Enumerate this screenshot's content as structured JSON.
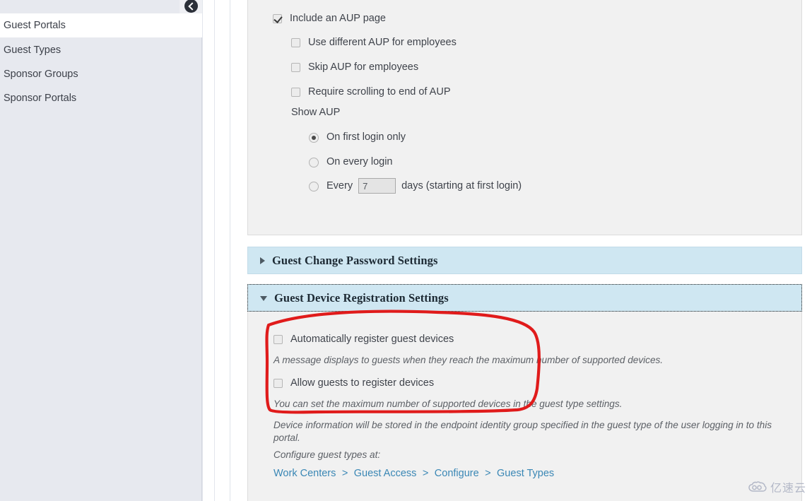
{
  "sidebar": {
    "collapse_icon": "chevron-left-circle-icon",
    "items": [
      {
        "label": "Guest Portals",
        "selected": true
      },
      {
        "label": "Guest Types",
        "selected": false
      },
      {
        "label": "Sponsor Groups",
        "selected": false
      },
      {
        "label": "Sponsor Portals",
        "selected": false
      }
    ]
  },
  "aup_panel": {
    "include_aup": {
      "label": "Include an AUP page",
      "checked": true
    },
    "sub_options": [
      {
        "label": "Use different AUP for employees",
        "checked": false
      },
      {
        "label": "Skip AUP for employees",
        "checked": false
      },
      {
        "label": "Require scrolling to end of AUP",
        "checked": false
      }
    ],
    "show_aup_label": "Show AUP",
    "radio_options": [
      {
        "label": "On first login only",
        "selected": true
      },
      {
        "label": "On every login",
        "selected": false
      },
      {
        "label": "Every",
        "selected": false
      }
    ],
    "days_value": "7",
    "days_placeholder": "",
    "days_suffix": "days (starting at first login)"
  },
  "accordions": [
    {
      "title": "Guest Change Password Settings",
      "expanded": false,
      "arrow": "triangle-right-icon"
    },
    {
      "title": "Guest Device Registration Settings",
      "expanded": true,
      "arrow": "triangle-down-icon"
    }
  ],
  "device_panel": {
    "checkboxes": [
      {
        "label": "Automatically register guest devices",
        "checked": false
      },
      {
        "label": "Allow guests to register devices",
        "checked": false
      }
    ],
    "help_texts": [
      "A message displays to guests when they reach the maximum number of supported devices.",
      "You can set the maximum number of supported devices in the guest type settings.",
      "Device information will be stored in the endpoint identity group specified in the guest type of the user logging in to this portal.",
      "Configure guest types at:"
    ],
    "breadcrumb_link": [
      "Work Centers",
      "Guest Access",
      "Configure",
      "Guest Types"
    ],
    "breadcrumb_separator": ">"
  },
  "annotation": {
    "shape": "hand-drawn-red-ellipse",
    "color": "#e01b1b"
  },
  "watermark": {
    "text": "亿速云",
    "icon": "cloud-icon",
    "color": "#a9afc0"
  },
  "colors": {
    "sidebar_bg": "#e7e9ef",
    "panel_bg": "#f1f1f1",
    "accordion_bg": "#cfe7f2",
    "link": "#3a87b5",
    "annotation_red": "#e01b1b"
  }
}
